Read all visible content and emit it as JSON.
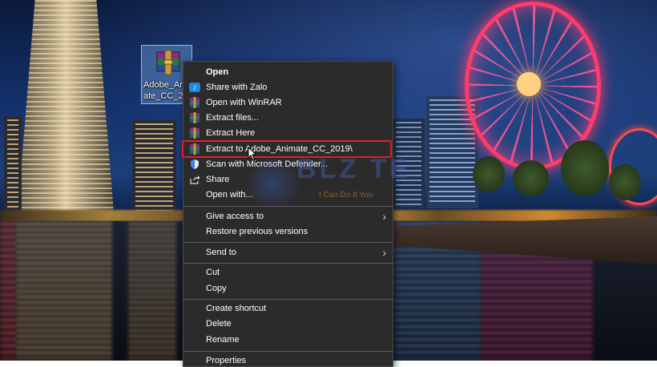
{
  "desktop": {
    "icon_name": "winrar-archive-icon",
    "file_label": "Adobe_Animate_CC_2019",
    "file_label_display": "Adobe_Ani\nate_CC_201"
  },
  "context_menu": {
    "items": [
      {
        "id": "open",
        "label": "Open",
        "bold": true,
        "icon": ""
      },
      {
        "id": "share-with-zalo",
        "label": "Share with Zalo",
        "icon": "zalo-icon"
      },
      {
        "id": "open-with-winrar",
        "label": "Open with WinRAR",
        "icon": "winrar-icon"
      },
      {
        "id": "extract-files",
        "label": "Extract files...",
        "icon": "winrar-icon"
      },
      {
        "id": "extract-here",
        "label": "Extract Here",
        "icon": "winrar-icon"
      },
      {
        "id": "extract-to",
        "label": "Extract to Adobe_Animate_CC_2019\\",
        "icon": "winrar-icon",
        "highlighted": true
      },
      {
        "id": "scan-defender",
        "label": "Scan with Microsoft Defender...",
        "icon": "defender-shield-icon"
      },
      {
        "id": "share",
        "label": "Share",
        "icon": "share-icon"
      },
      {
        "id": "open-with",
        "label": "Open with...",
        "icon": ""
      },
      {
        "id": "give-access-to",
        "label": "Give access to",
        "icon": "",
        "submenu": true
      },
      {
        "id": "restore-previous-versions",
        "label": "Restore previous versions",
        "icon": ""
      },
      {
        "id": "send-to",
        "label": "Send to",
        "icon": "",
        "submenu": true
      },
      {
        "id": "cut",
        "label": "Cut",
        "icon": ""
      },
      {
        "id": "copy",
        "label": "Copy",
        "icon": ""
      },
      {
        "id": "create-shortcut",
        "label": "Create shortcut",
        "icon": ""
      },
      {
        "id": "delete",
        "label": "Delete",
        "icon": ""
      },
      {
        "id": "rename",
        "label": "Rename",
        "icon": ""
      },
      {
        "id": "properties",
        "label": "Properties",
        "icon": ""
      }
    ],
    "submenu_arrow": "›"
  },
  "watermark": {
    "title": "BLZ TE",
    "subtitle": "I Can Do It You"
  },
  "colors": {
    "menu_background": "#2b2b2b",
    "highlight_border": "#e01e26"
  }
}
